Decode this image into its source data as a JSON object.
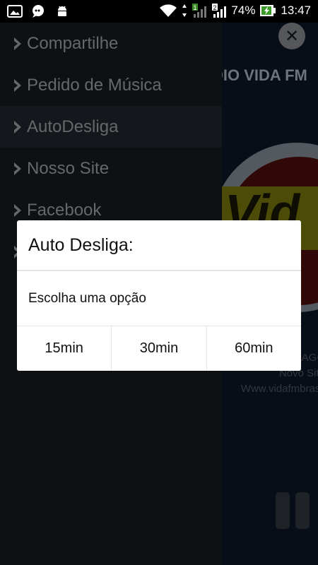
{
  "status_bar": {
    "battery": "74%",
    "time": "13:47",
    "sim1": "1",
    "sim2": "2"
  },
  "player": {
    "station_title": "DIO VIDA FM",
    "logo_text": "Vid",
    "sub_line1": "AGO",
    "sub_line2": "Novo Site",
    "sub_line3": "Www.vidafmbrasil"
  },
  "drawer": {
    "items": [
      {
        "label": "Compartilhe"
      },
      {
        "label": "Pedido de Música"
      },
      {
        "label": "AutoDesliga"
      },
      {
        "label": "Nosso Site"
      },
      {
        "label": "Facebook"
      }
    ]
  },
  "dialog": {
    "title": "Auto Desliga:",
    "message": "Escolha uma opção",
    "options": [
      "15min",
      "30min",
      "60min"
    ]
  },
  "colors": {
    "drawer_bg": "#1b1f24",
    "drawer_text": "#b8bcc2",
    "dialog_bg": "#ffffff",
    "player_bg": "#0f1a2b"
  }
}
